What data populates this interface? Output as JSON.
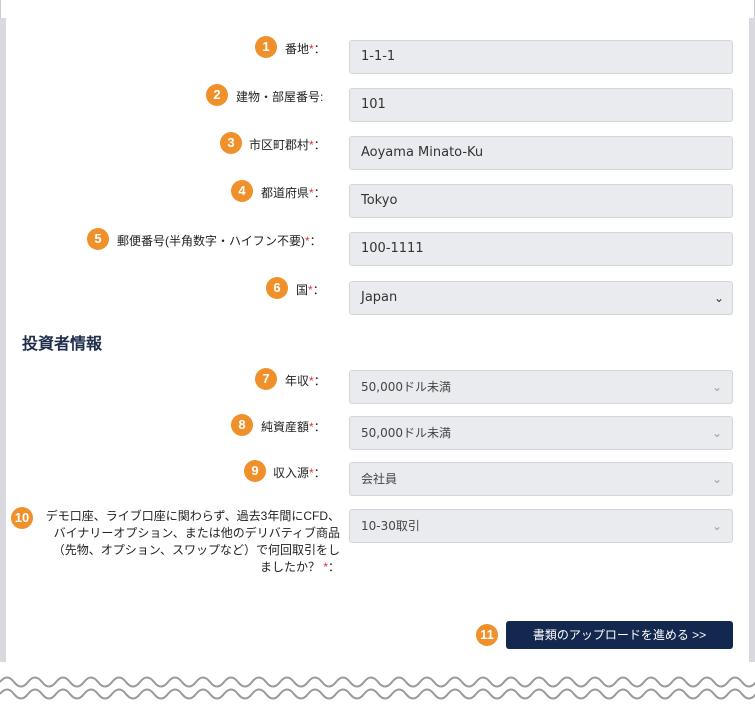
{
  "fields": [
    {
      "num": "1",
      "label": "番地",
      "required": true,
      "colon": "：",
      "value": "1-1-1"
    },
    {
      "num": "2",
      "label": "建物・部屋番号:",
      "required": false,
      "colon": "",
      "value": "101"
    },
    {
      "num": "3",
      "label": "市区町郡村",
      "required": true,
      "colon": "：",
      "value": "Aoyama Minato-Ku"
    },
    {
      "num": "4",
      "label": "都道府県",
      "required": true,
      "colon": "：",
      "value": "Tokyo"
    },
    {
      "num": "5",
      "label": "郵便番号(半角数字・ハイフン不要)",
      "required": true,
      "colon": "：",
      "value": "100-1111"
    },
    {
      "num": "6",
      "label": "国",
      "required": true,
      "colon": "：",
      "value": "Japan"
    }
  ],
  "section_title": "投資者情報",
  "investor": [
    {
      "num": "7",
      "label": "年収",
      "required": true,
      "colon": "：",
      "value": "50,000ドル未満"
    },
    {
      "num": "8",
      "label": "純資産額",
      "required": true,
      "colon": "：",
      "value": "50,000ドル未満"
    },
    {
      "num": "9",
      "label": "収入源",
      "required": true,
      "colon": "：",
      "value": "会社員"
    },
    {
      "num": "10",
      "label_lines": [
        "デモ口座、ライブ口座に関わらず、過去3年間にCFD、",
        "バイナリーオプション、または他のデリバティブ商品",
        "（先物、オプション、スワップなど）で何回取引をし",
        "ましたか？"
      ],
      "required": true,
      "colon": "：",
      "value": "10-30取引"
    }
  ],
  "submit": {
    "num": "11",
    "label": "書類のアップロードを進める >>"
  },
  "req_mark": "*",
  "icons": {
    "chevron": "chevron-down-icon"
  },
  "colors": {
    "badge": "#f0902a",
    "button": "#13284f",
    "required": "#e2303a"
  }
}
